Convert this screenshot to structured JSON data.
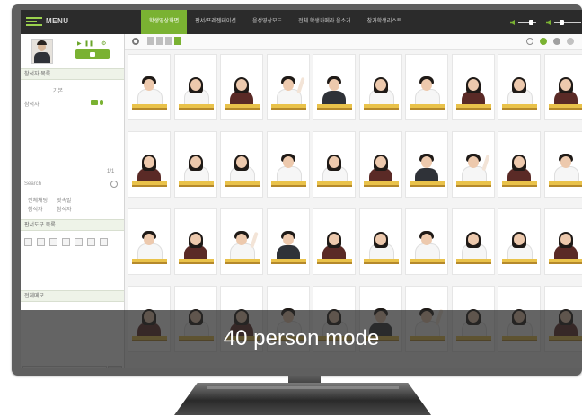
{
  "app": {
    "menu_label": "MENU"
  },
  "tabs": [
    {
      "label": "학생영상화면"
    },
    {
      "label": "판서/프레젠테이션"
    },
    {
      "label": "음성영상모드"
    },
    {
      "label": "전체 학생카메라 음소거"
    },
    {
      "label": "참가학생리스트"
    }
  ],
  "sidebar": {
    "participant_header": "참석자 목록",
    "subheader": "기본",
    "me_label": "참석자",
    "counter": "1/1",
    "search_placeholder": "Search",
    "options": [
      "전체채팅",
      "귓속말",
      "참석자",
      "참석자"
    ],
    "chat_header": "판서도구 목록",
    "notice_header": "전체메모"
  },
  "banner": {
    "text": "40 person mode"
  },
  "colors": {
    "accent": "#7ab232",
    "topbar": "#2b2b2b",
    "desk": "#e9c24a"
  },
  "students": [
    {
      "uniform": "white",
      "hair": "short",
      "raise": false
    },
    {
      "uniform": "white",
      "hair": "long",
      "raise": false
    },
    {
      "uniform": "vest",
      "hair": "long",
      "raise": false
    },
    {
      "uniform": "white",
      "hair": "short",
      "raise": true
    },
    {
      "uniform": "dark",
      "hair": "short",
      "raise": false
    },
    {
      "uniform": "white",
      "hair": "long",
      "raise": false
    },
    {
      "uniform": "white",
      "hair": "short",
      "raise": false
    },
    {
      "uniform": "vest",
      "hair": "long",
      "raise": false
    },
    {
      "uniform": "white",
      "hair": "long",
      "raise": false
    },
    {
      "uniform": "vest",
      "hair": "long",
      "raise": false
    },
    {
      "uniform": "vest",
      "hair": "long",
      "raise": false
    },
    {
      "uniform": "white",
      "hair": "long",
      "raise": false
    },
    {
      "uniform": "white",
      "hair": "long",
      "raise": false
    },
    {
      "uniform": "white",
      "hair": "short",
      "raise": false
    },
    {
      "uniform": "white",
      "hair": "long",
      "raise": false
    },
    {
      "uniform": "vest",
      "hair": "long",
      "raise": false
    },
    {
      "uniform": "dark",
      "hair": "short",
      "raise": false
    },
    {
      "uniform": "white",
      "hair": "short",
      "raise": true
    },
    {
      "uniform": "vest",
      "hair": "long",
      "raise": false
    },
    {
      "uniform": "white",
      "hair": "short",
      "raise": false
    },
    {
      "uniform": "white",
      "hair": "short",
      "raise": false
    },
    {
      "uniform": "vest",
      "hair": "long",
      "raise": false
    },
    {
      "uniform": "white",
      "hair": "short",
      "raise": true
    },
    {
      "uniform": "dark",
      "hair": "short",
      "raise": false
    },
    {
      "uniform": "vest",
      "hair": "long",
      "raise": false
    },
    {
      "uniform": "white",
      "hair": "long",
      "raise": false
    },
    {
      "uniform": "white",
      "hair": "short",
      "raise": false
    },
    {
      "uniform": "white",
      "hair": "long",
      "raise": false
    },
    {
      "uniform": "white",
      "hair": "long",
      "raise": false
    },
    {
      "uniform": "vest",
      "hair": "long",
      "raise": false
    },
    {
      "uniform": "vest",
      "hair": "long",
      "raise": false
    },
    {
      "uniform": "white",
      "hair": "long",
      "raise": false
    },
    {
      "uniform": "vest",
      "hair": "long",
      "raise": false
    },
    {
      "uniform": "white",
      "hair": "short",
      "raise": false
    },
    {
      "uniform": "white",
      "hair": "long",
      "raise": false
    },
    {
      "uniform": "dark",
      "hair": "short",
      "raise": false
    },
    {
      "uniform": "white",
      "hair": "short",
      "raise": true
    },
    {
      "uniform": "white",
      "hair": "long",
      "raise": false
    },
    {
      "uniform": "white",
      "hair": "long",
      "raise": false
    },
    {
      "uniform": "vest",
      "hair": "long",
      "raise": false
    }
  ]
}
